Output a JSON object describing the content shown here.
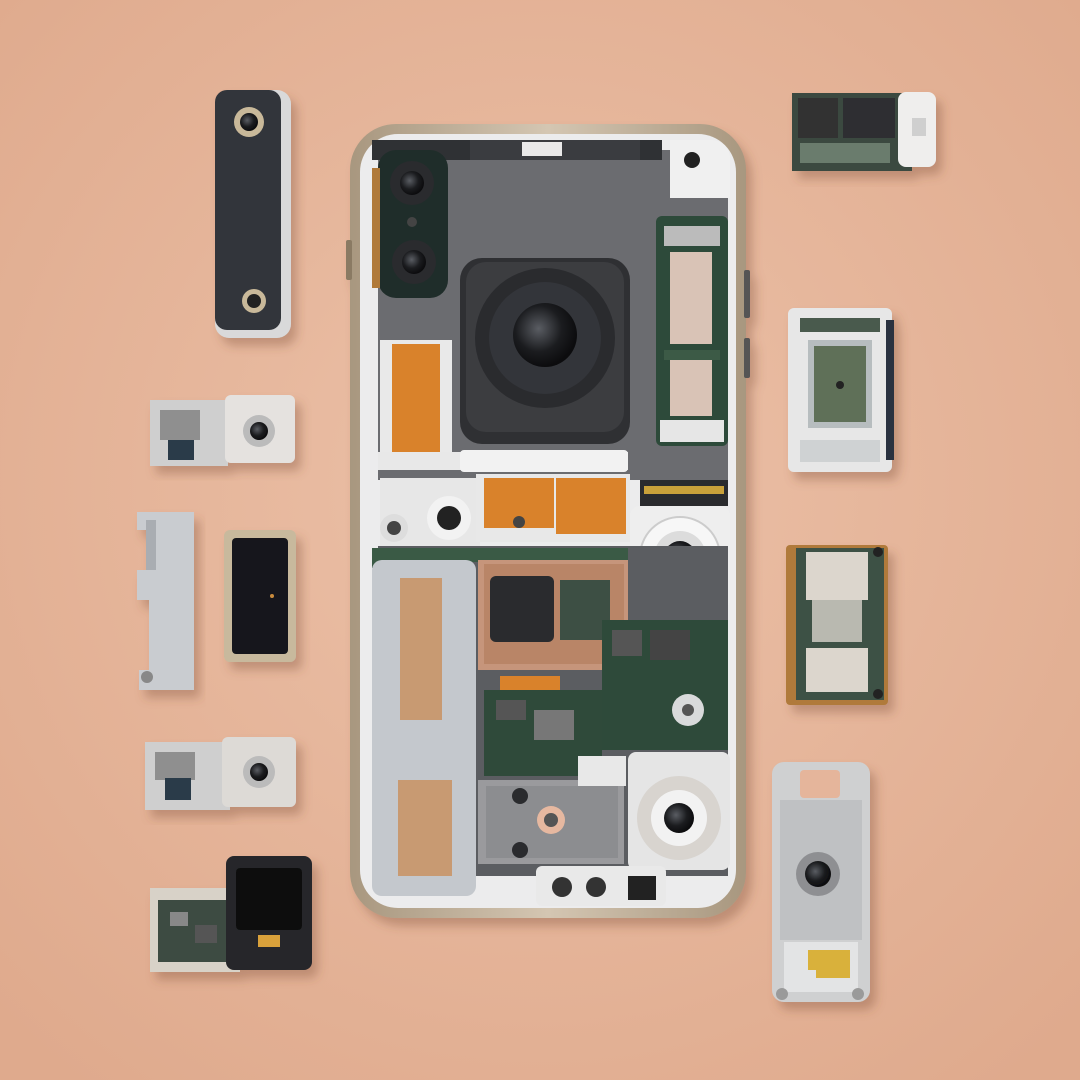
{
  "scene": {
    "kind": "photo",
    "subject": "knolling-layout-disassembled-smartphone",
    "text_visible": false
  },
  "colors": {
    "background": "#e5b59b",
    "frame_metal": "#b9a88f",
    "frame_inner": "#ededee",
    "housing_dark": "#3a3b3d",
    "housing_grey": "#6a6c70",
    "pcb_green": "#2e4a3a",
    "copper_orange": "#d9822b",
    "bracket_white": "#e8e8e8",
    "bracket_grey": "#c9ccd0",
    "gold_contact": "#d9b13a"
  },
  "parts": {
    "left_column": [
      "black-camera-bar",
      "camera-module-small-1",
      "grey-l-bracket",
      "black-shield-plate",
      "camera-module-small-2",
      "pcb-with-black-chip"
    ],
    "right_column": [
      "pcb-with-white-connector",
      "camera-flex-board",
      "battery-connector-board",
      "silver-camera-housing"
    ],
    "phone_internals": [
      "triple-lens-bar",
      "main-camera-module",
      "orange-flex-cable-left",
      "orange-flex-cable-mid",
      "right-pcb-strip",
      "round-camera-right",
      "logic-board",
      "grey-bracket-left",
      "bottom-camera-module",
      "bottom-speaker-ports"
    ]
  }
}
